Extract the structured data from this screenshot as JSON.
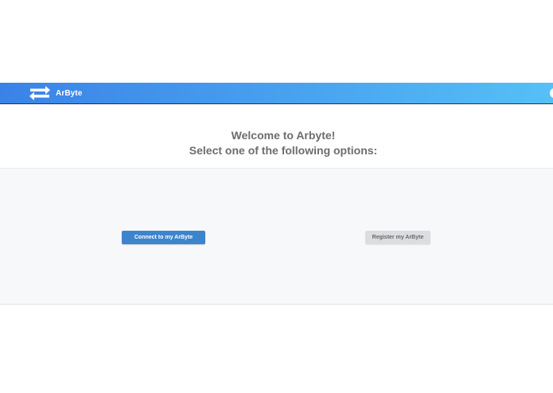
{
  "navbar": {
    "brand_label": "ArByte",
    "brand_icon": "swap-arrows-icon",
    "gradient_start": "#3b82e8",
    "gradient_end": "#56c0f6"
  },
  "welcome": {
    "line1": "Welcome to Arbyte!",
    "line2": "Select one of the following options:"
  },
  "actions": {
    "connect_label": "Connect to my ArByte",
    "register_label": "Register my ArByte",
    "primary_color": "#3d84cf",
    "secondary_color": "#dcdde0"
  }
}
